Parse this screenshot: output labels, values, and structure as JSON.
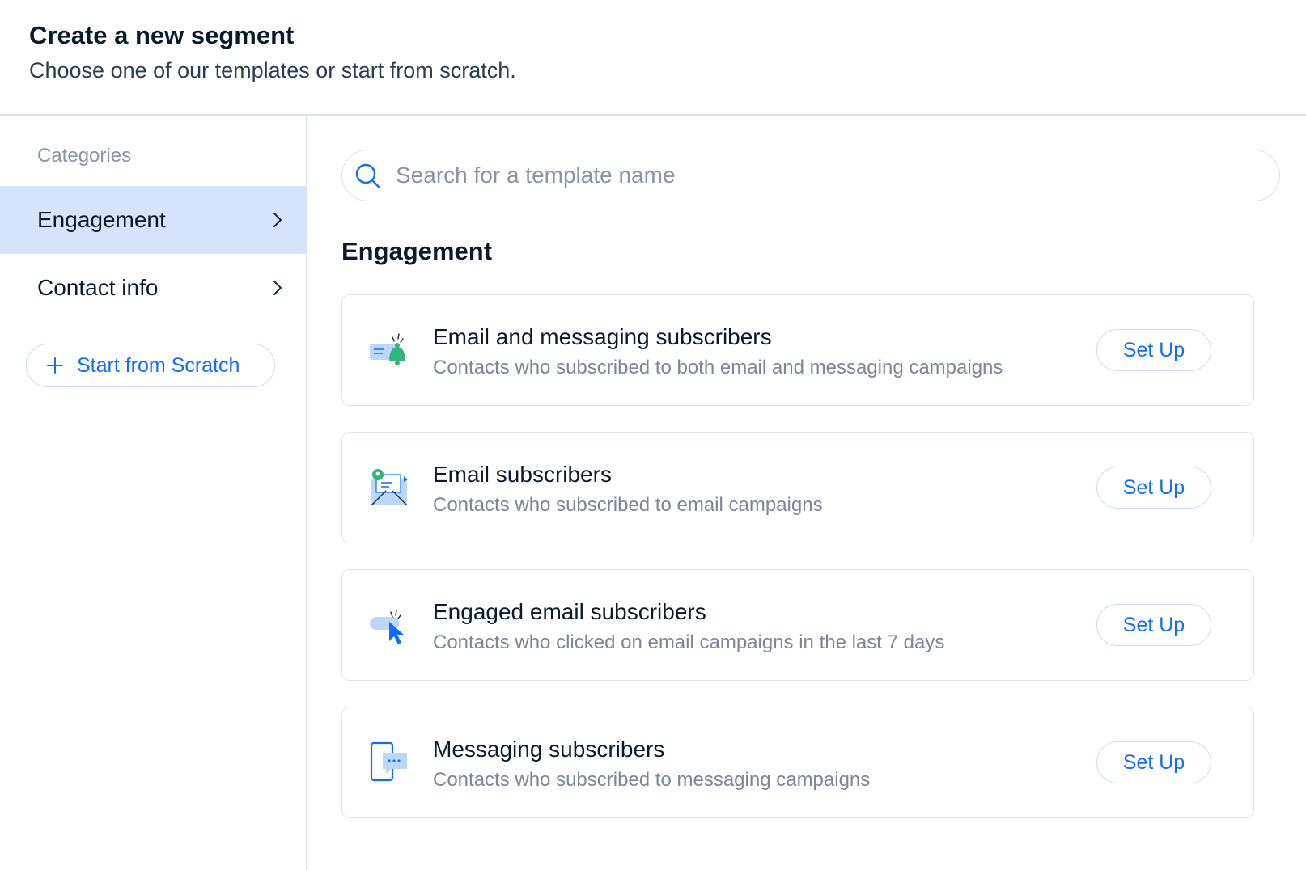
{
  "header": {
    "title": "Create a new segment",
    "subtitle": "Choose one of our templates or start from scratch."
  },
  "sidebar": {
    "caption": "Categories",
    "items": [
      {
        "label": "Engagement",
        "active": true,
        "icon": "chevron-right-icon"
      },
      {
        "label": "Contact info",
        "active": false,
        "icon": "chevron-right-icon"
      }
    ],
    "scratch_button": {
      "label": "Start from Scratch",
      "icon": "plus-icon"
    }
  },
  "search": {
    "placeholder": "Search for a template name",
    "value": "",
    "icon": "search-icon"
  },
  "section": {
    "title": "Engagement"
  },
  "templates": [
    {
      "title": "Email and messaging subscribers",
      "description": "Contacts who subscribed to both email and messaging campaigns",
      "icon": "bell-email-icon",
      "button_label": "Set Up"
    },
    {
      "title": "Email subscribers",
      "description": "Contacts who subscribed to email campaigns",
      "icon": "envelope-icon",
      "button_label": "Set Up"
    },
    {
      "title": "Engaged email subscribers",
      "description": "Contacts who clicked on email campaigns in the last 7 days",
      "icon": "cursor-click-icon",
      "button_label": "Set Up"
    },
    {
      "title": "Messaging subscribers",
      "description": "Contacts who subscribed to messaging campaigns",
      "icon": "phone-chat-icon",
      "button_label": "Set Up"
    }
  ],
  "colors": {
    "accent": "#116dff",
    "active_bg": "#d5e4fc",
    "border": "#dfe5eb",
    "heading": "#0c1b2c",
    "muted": "#7c8694",
    "green": "#2fb67c",
    "light_blue": "#bcd7fb"
  }
}
